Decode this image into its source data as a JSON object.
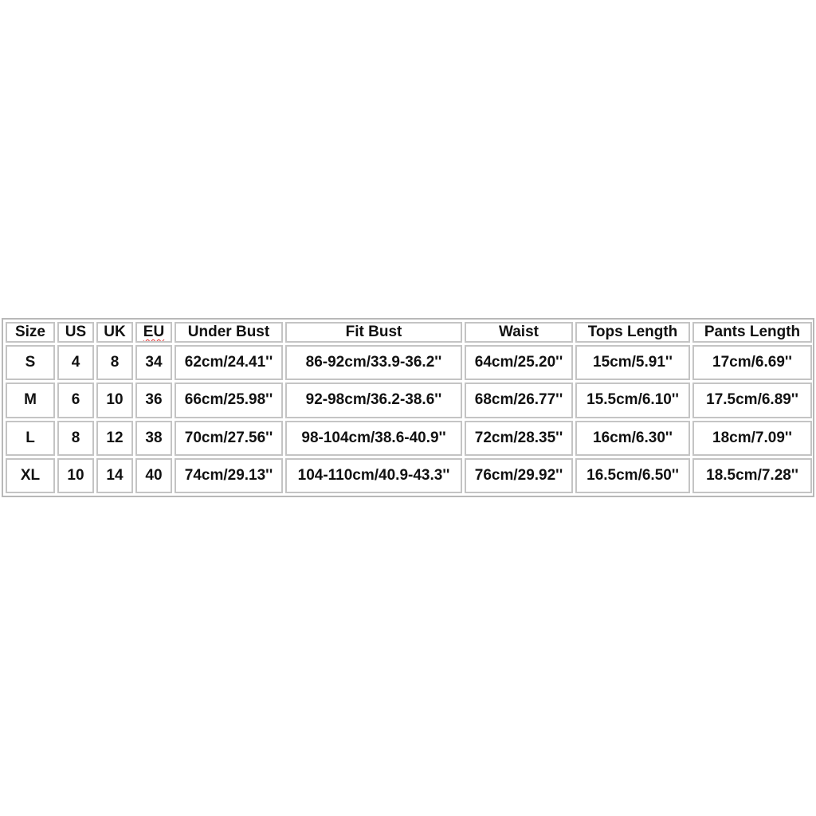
{
  "size_chart": {
    "headers": [
      "Size",
      "US",
      "UK",
      "EU",
      "Under Bust",
      "Fit Bust",
      "Waist",
      "Tops Length",
      "Pants Length"
    ],
    "rows": [
      [
        "S",
        "4",
        "8",
        "34",
        "62cm/24.41''",
        "86-92cm/33.9-36.2''",
        "64cm/25.20''",
        "15cm/5.91''",
        "17cm/6.69''"
      ],
      [
        "M",
        "6",
        "10",
        "36",
        "66cm/25.98''",
        "92-98cm/36.2-38.6''",
        "68cm/26.77''",
        "15.5cm/6.10''",
        "17.5cm/6.89''"
      ],
      [
        "L",
        "8",
        "12",
        "38",
        "70cm/27.56''",
        "98-104cm/38.6-40.9''",
        "72cm/28.35''",
        "16cm/6.30''",
        "18cm/7.09''"
      ],
      [
        "XL",
        "10",
        "14",
        "40",
        "74cm/29.13''",
        "104-110cm/40.9-43.3''",
        "76cm/29.92''",
        "16.5cm/6.50''",
        "18.5cm/7.28''"
      ]
    ]
  },
  "colors": {
    "border": "#c4c4c4",
    "outer_border": "#b8b8b8",
    "text": "#111111",
    "spellcheck_underline": "#e03030"
  }
}
